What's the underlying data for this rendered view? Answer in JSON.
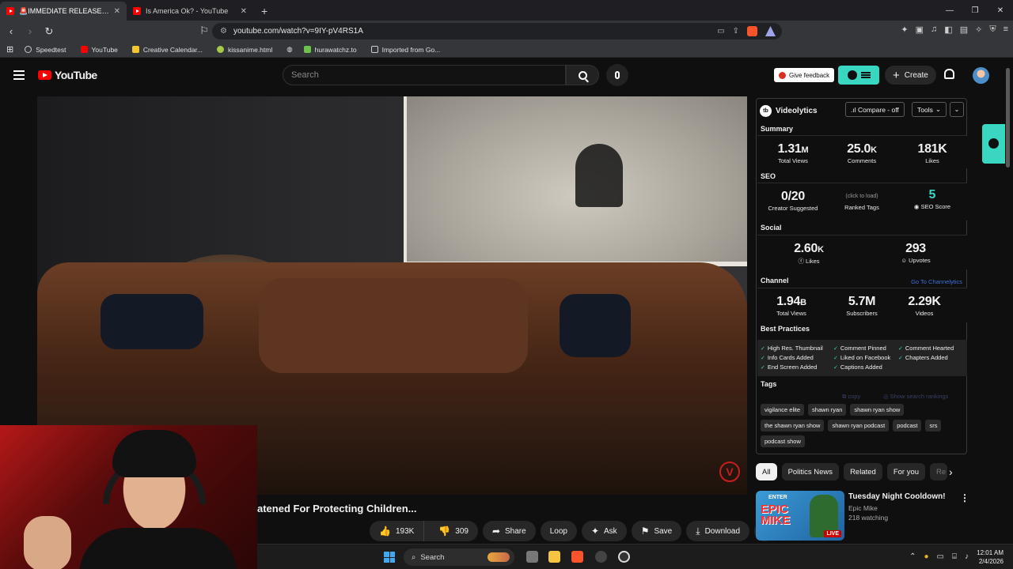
{
  "browser": {
    "tabs": [
      {
        "title": "🚨IMMEDIATE RELEASE🚨 - I A",
        "active": true
      },
      {
        "title": "Is America Ok? - YouTube",
        "active": false
      }
    ],
    "url": "youtube.com/watch?v=9IY-pV4RS1A",
    "bookmarks": [
      "Speedtest",
      "YouTube",
      "Creative Calendar...",
      "kissanime.html",
      "hurawatchz.to",
      "Imported from Go..."
    ]
  },
  "youtube": {
    "logo_text": "YouTube",
    "search_placeholder": "Search",
    "give_feedback": "Give feedback",
    "create": "Create",
    "video_title": "atened For Protecting Children...",
    "actions": {
      "likes": "193K",
      "dislikes": "309",
      "share": "Share",
      "loop": "Loop",
      "ask": "Ask",
      "save": "Save",
      "download": "Download",
      "more": "•••"
    },
    "chips": [
      "All",
      "Politics News",
      "Related",
      "For you",
      "Re"
    ],
    "recommendation": {
      "title": "Tuesday Night Cooldown!",
      "channel": "Epic Mike",
      "watching": "218 watching",
      "thumb_top": "ENTER",
      "thumb_word1": "EPIC",
      "thumb_word2": "MIKE",
      "live": "LIVE"
    }
  },
  "videolytics": {
    "name": "Videolytics",
    "compare": ".ıl Compare - off",
    "tools": "Tools",
    "summary": {
      "heading": "Summary",
      "total_views": {
        "num": "1.31",
        "unit": "M",
        "label": "Total Views"
      },
      "comments": {
        "num": "25.0",
        "unit": "K",
        "label": "Comments"
      },
      "likes": {
        "num": "181K",
        "label": "Likes"
      }
    },
    "seo": {
      "heading": "SEO",
      "creator_suggested": {
        "value": "0/20",
        "label": "Creator Suggested"
      },
      "ranked_tags": {
        "value": "(click to load)",
        "label": "Ranked Tags"
      },
      "seo_score": {
        "value": "5",
        "label": "SEO Score"
      }
    },
    "social": {
      "heading": "Social",
      "likes": {
        "num": "2.60",
        "unit": "K",
        "label": "Likes"
      },
      "upvotes": {
        "value": "293",
        "label": "Upvotes"
      }
    },
    "channel": {
      "heading": "Channel",
      "link": "Go To Channelytics",
      "total_views": {
        "num": "1.94",
        "unit": "B",
        "label": "Total Views"
      },
      "subscribers": {
        "value": "5.7M",
        "label": "Subscribers"
      },
      "videos": {
        "value": "2.29K",
        "label": "Videos"
      }
    },
    "best_practices": {
      "heading": "Best Practices",
      "items": [
        "High Res. Thumbnail",
        "Comment Pinned",
        "Comment Hearted",
        "Info Cards Added",
        "Liked on Facebook",
        "Chapters Added",
        "End Screen Added",
        "Captions Added"
      ]
    },
    "tags": {
      "heading": "Tags",
      "copy": "copy",
      "show_rankings": "Show search rankings",
      "items": [
        "vigilance elite",
        "shawn ryan",
        "shawn ryan show",
        "the shawn ryan show",
        "shawn ryan podcast",
        "podcast",
        "srs",
        "podcast show"
      ]
    }
  },
  "taskbar": {
    "search": "Search",
    "time": "12:01 AM",
    "date": "2/4/2026"
  },
  "colors": {
    "accent": "#39d6c1",
    "youtube_red": "#ff0000",
    "link_blue": "#3e6fd8"
  }
}
